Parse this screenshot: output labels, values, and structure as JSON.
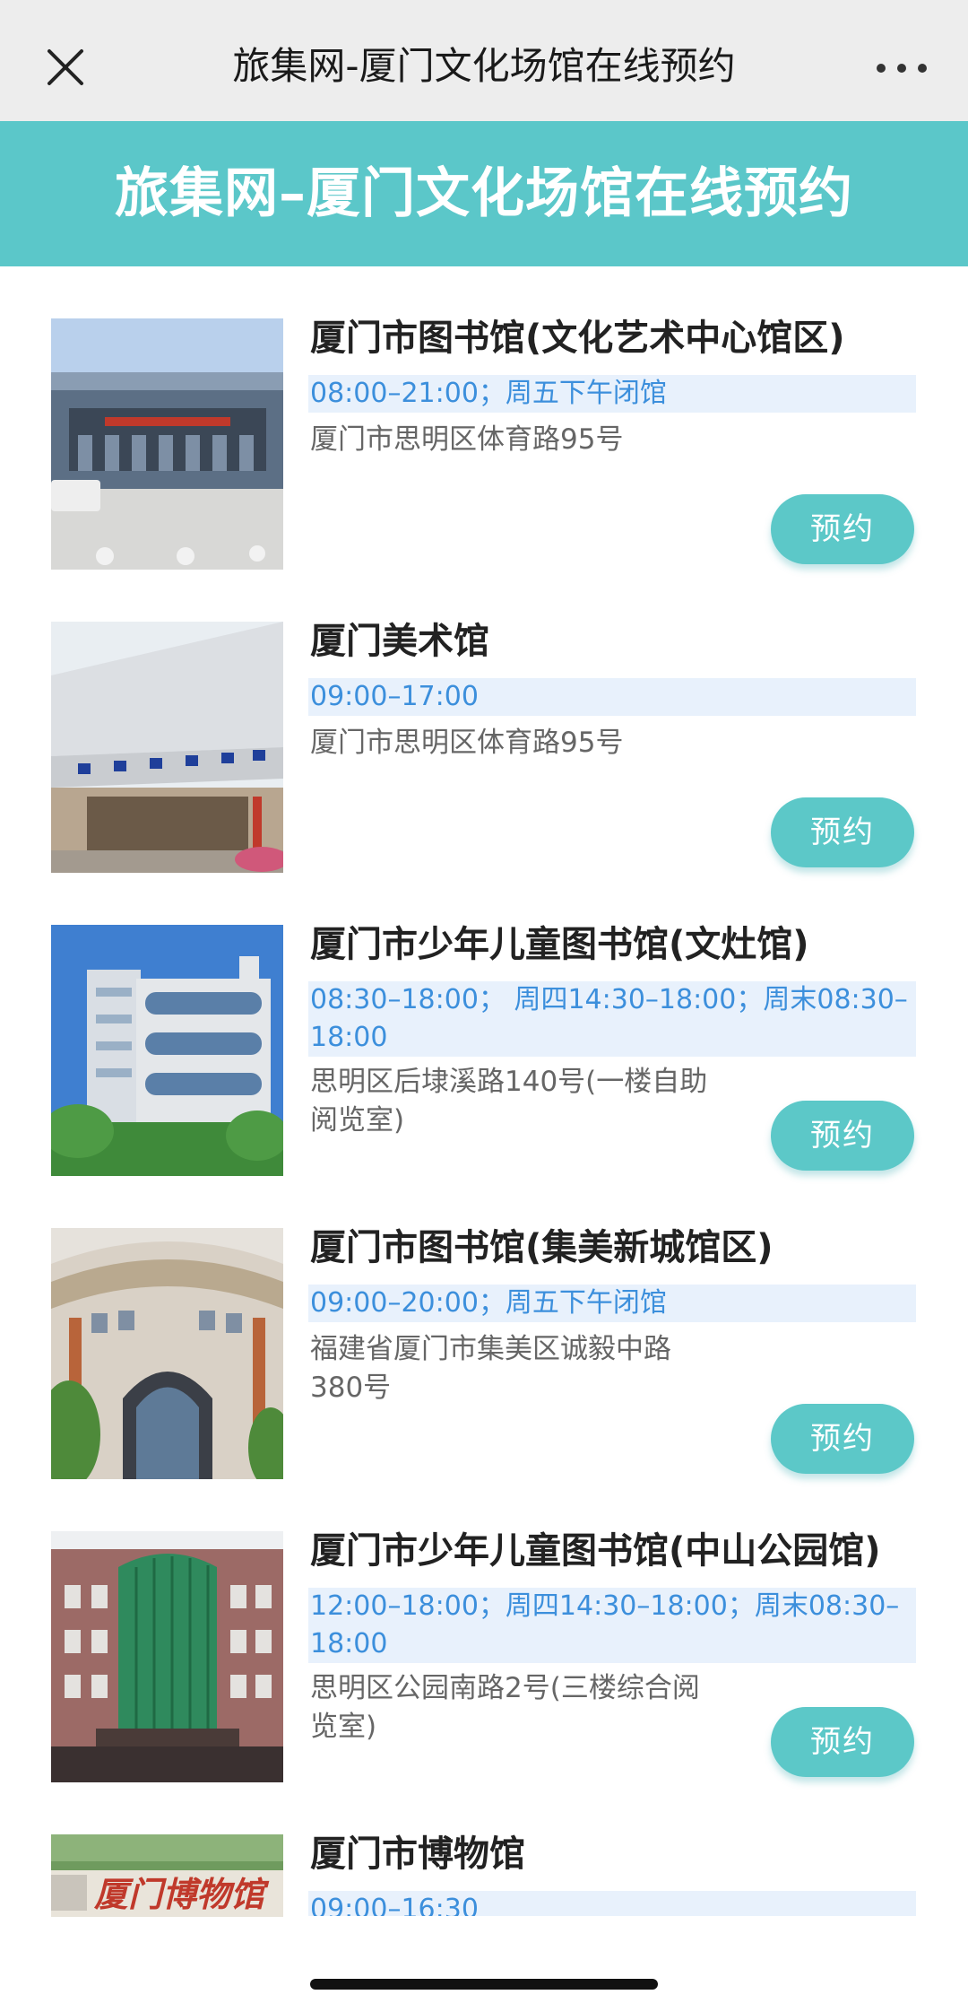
{
  "topbar": {
    "title": "旅集网-厦门文化场馆在线预约"
  },
  "banner": {
    "title": "旅集网–厦门文化场馆在线预约"
  },
  "venues": [
    {
      "name": "厦门市图书馆(文化艺术中心馆区)",
      "hours": "08:00–21:00；周五下午闭馆",
      "address": "厦门市思明区体育路95号",
      "button": "预约"
    },
    {
      "name": "厦门美术馆",
      "hours": "09:00–17:00",
      "address": "厦门市思明区体育路95号",
      "button": "预约"
    },
    {
      "name": "厦门市少年儿童图书馆(文灶馆)",
      "hours": "08:30–18:00； 周四14:30–18:00；周末08:30–18:00",
      "address": "思明区后埭溪路140号(一楼自助阅览室)",
      "button": "预约"
    },
    {
      "name": "厦门市图书馆(集美新城馆区)",
      "hours": "09:00–20:00；周五下午闭馆",
      "address": "福建省厦门市集美区诚毅中路380号",
      "button": "预约"
    },
    {
      "name": "厦门市少年儿童图书馆(中山公园馆)",
      "hours": "12:00–18:00；周四14:30–18:00；周末08:30–18:00",
      "address": "思明区公园南路2号(三楼综合阅览室)",
      "button": "预约"
    },
    {
      "name": "厦门市博物馆",
      "hours": "09:00–16:30",
      "sign": "厦门博物馆"
    }
  ],
  "colors": {
    "accent": "#5bc7c9",
    "hours_text": "#3c8fdc",
    "hours_bg": "#e8f1fc"
  }
}
